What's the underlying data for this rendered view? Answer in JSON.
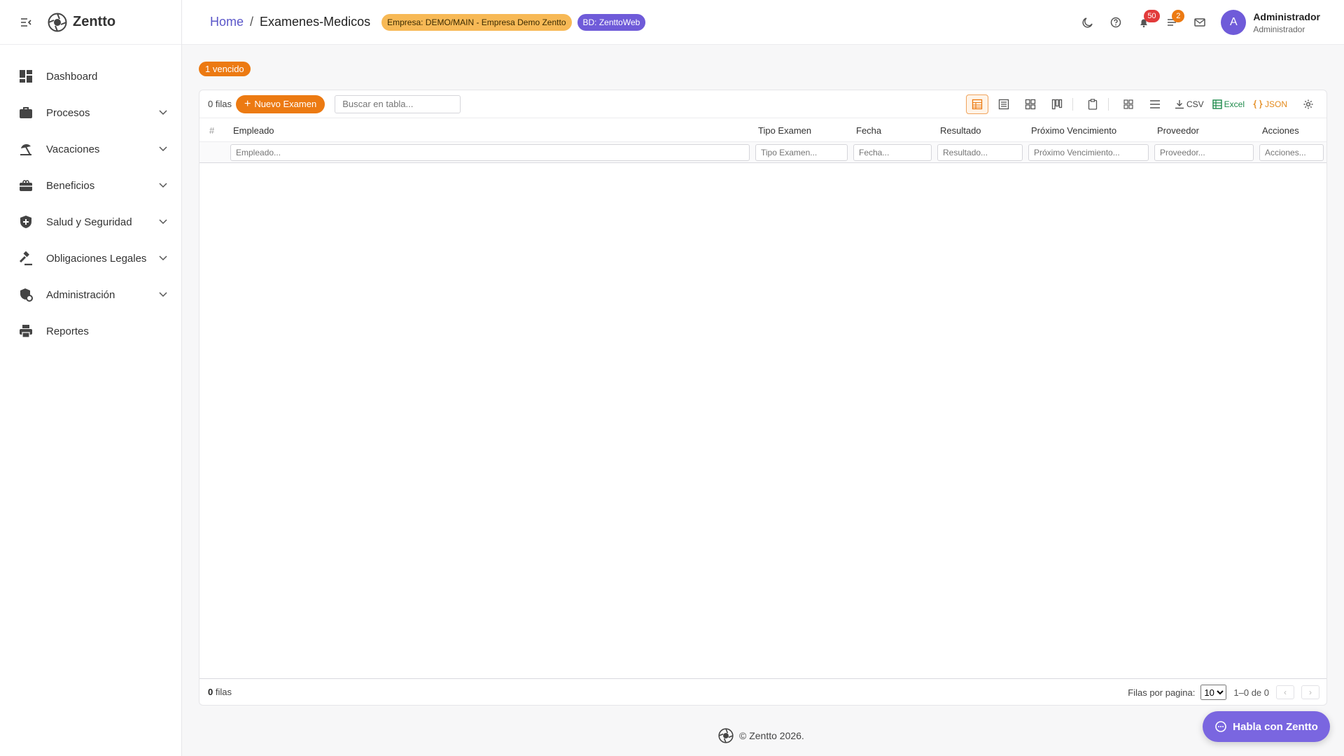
{
  "app": {
    "name": "Zentto"
  },
  "sidebar": {
    "items": [
      {
        "label": "Dashboard",
        "icon": "dashboard-icon",
        "expandable": false
      },
      {
        "label": "Procesos",
        "icon": "briefcase-icon",
        "expandable": true
      },
      {
        "label": "Vacaciones",
        "icon": "beach-icon",
        "expandable": true
      },
      {
        "label": "Beneficios",
        "icon": "gift-card-icon",
        "expandable": true
      },
      {
        "label": "Salud y Seguridad",
        "icon": "shield-icon",
        "expandable": true
      },
      {
        "label": "Obligaciones Legales",
        "icon": "gavel-icon",
        "expandable": true
      },
      {
        "label": "Administración",
        "icon": "admin-shield-icon",
        "expandable": true
      },
      {
        "label": "Reportes",
        "icon": "printer-icon",
        "expandable": false
      }
    ]
  },
  "header": {
    "breadcrumb_home": "Home",
    "breadcrumb_separator": "/",
    "breadcrumb_current": "Examenes-Medicos",
    "company_badge": "Empresa: DEMO/MAIN - Empresa Demo Zentto",
    "db_badge": "BD: ZenttoWeb",
    "notifications_count": "50",
    "tasks_count": "2",
    "avatar_letter": "A",
    "user_name": "Administrador",
    "user_role": "Administrador"
  },
  "content": {
    "expired_pill": "1 vencido",
    "toolbar": {
      "rows_count": "0 filas",
      "new_button": "Nuevo Examen",
      "search_placeholder": "Buscar en tabla...",
      "csv": "CSV",
      "excel": "Excel",
      "json": "JSON"
    },
    "columns": [
      "#",
      "Empleado",
      "Tipo Examen",
      "Fecha",
      "Resultado",
      "Próximo Vencimiento",
      "Proveedor",
      "Acciones"
    ],
    "filters": [
      "Empleado...",
      "Tipo Examen...",
      "Fecha...",
      "Resultado...",
      "Próximo Vencimiento...",
      "Proveedor...",
      "Acciones..."
    ],
    "footer": {
      "rows_number": "0",
      "rows_word": "filas",
      "per_page_label": "Filas por pagina:",
      "per_page_value": "10",
      "range": "1–0 de 0"
    }
  },
  "footer_text": "© Zentto 2026.",
  "chat_button": "Habla con Zentto",
  "colors": {
    "accent_orange": "#ec7a12",
    "accent_purple": "#6f5bd9",
    "company_badge": "#f7b956",
    "badge_red": "#e23b3b"
  }
}
